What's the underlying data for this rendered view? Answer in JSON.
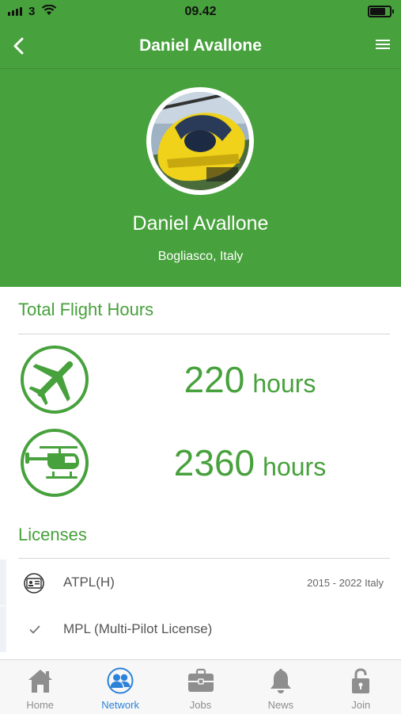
{
  "status": {
    "carrier": "3",
    "time": "09.42"
  },
  "header": {
    "title": "Daniel Avallone",
    "back_icon": "chevron-left-icon",
    "menu_icon": "hamburger-menu-icon"
  },
  "profile": {
    "name": "Daniel Avallone",
    "location": "Bogliasco, Italy",
    "photo": "yellow-helicopter-photo"
  },
  "flight_hours": {
    "title": "Total Flight Hours",
    "rows": [
      {
        "aircraft": "airplane-icon",
        "hours": "220",
        "unit": "hours"
      },
      {
        "aircraft": "helicopter-icon",
        "hours": "2360",
        "unit": "hours"
      }
    ]
  },
  "licenses": {
    "title": "Licenses",
    "items": [
      {
        "icon": "license-card-icon",
        "name": "ATPL(H)",
        "meta": "2015 - 2022 Italy"
      },
      {
        "icon": "checkmark-icon",
        "name": "MPL (Multi-Pilot License)",
        "meta": ""
      }
    ]
  },
  "tabs": [
    {
      "label": "Home",
      "icon": "home-icon",
      "active": false
    },
    {
      "label": "Network",
      "icon": "network-icon",
      "active": true
    },
    {
      "label": "Jobs",
      "icon": "briefcase-icon",
      "active": false
    },
    {
      "label": "News",
      "icon": "bell-icon",
      "active": false
    },
    {
      "label": "Join",
      "icon": "unlock-icon",
      "active": false
    }
  ],
  "colors": {
    "brand_green": "#47a13c",
    "tab_active": "#2b82d9",
    "tab_inactive": "#8e8e8e"
  }
}
